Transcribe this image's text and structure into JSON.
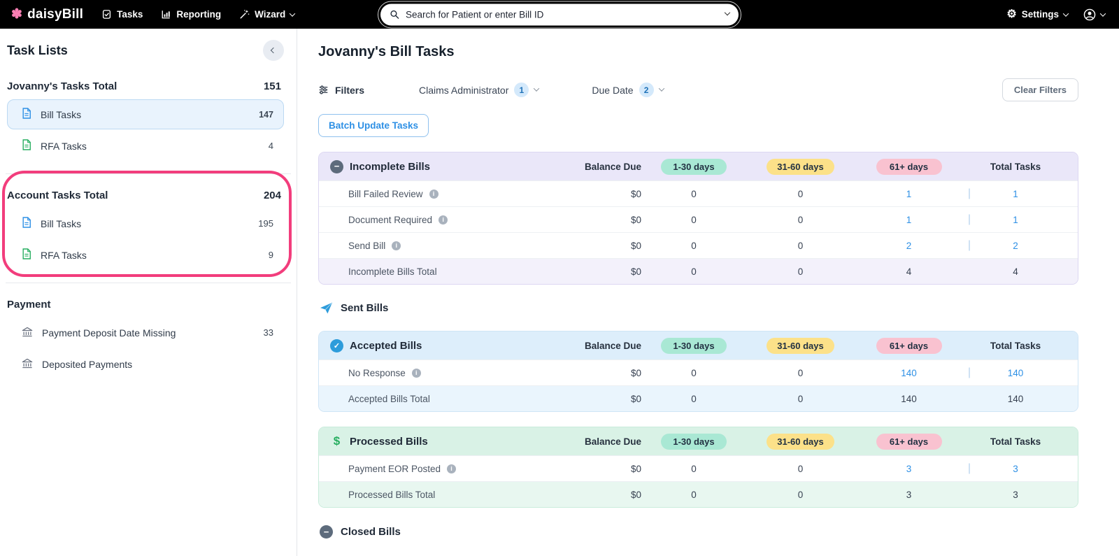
{
  "navbar": {
    "brand": "daisyBill",
    "tasks_label": "Tasks",
    "reporting_label": "Reporting",
    "wizard_label": "Wizard",
    "search_placeholder": "Search for Patient or enter Bill ID",
    "settings_label": "Settings"
  },
  "sidebar": {
    "title": "Task Lists",
    "sections": [
      {
        "heading": "Jovanny's Tasks Total",
        "count": "151",
        "items": [
          {
            "label": "Bill Tasks",
            "count": "147"
          },
          {
            "label": "RFA Tasks",
            "count": "4"
          }
        ]
      },
      {
        "heading": "Account Tasks Total",
        "count": "204",
        "items": [
          {
            "label": "Bill Tasks",
            "count": "195"
          },
          {
            "label": "RFA Tasks",
            "count": "9"
          }
        ]
      },
      {
        "heading": "Payment",
        "count": "",
        "items": [
          {
            "label": "Payment Deposit Date Missing",
            "count": "33"
          },
          {
            "label": "Deposited Payments",
            "count": ""
          }
        ]
      }
    ]
  },
  "main": {
    "title": "Jovanny's Bill Tasks",
    "filters_label": "Filters",
    "claims_admin_label": "Claims Administrator",
    "claims_admin_badge": "1",
    "due_date_label": "Due Date",
    "due_date_badge": "2",
    "clear_filters_label": "Clear Filters",
    "batch_update_label": "Batch Update Tasks",
    "sent_bills_label": "Sent Bills",
    "closed_bills_label": "Closed Bills",
    "columns": {
      "balance": "Balance Due",
      "d1": "1-30 days",
      "d2": "31-60 days",
      "d3": "61+ days",
      "total": "Total Tasks"
    },
    "tables": [
      {
        "title": "Incomplete Bills",
        "rows": [
          {
            "label": "Bill Failed Review",
            "balance": "$0",
            "d1": "0",
            "d2": "0",
            "d3": "1",
            "total": "1"
          },
          {
            "label": "Document Required",
            "balance": "$0",
            "d1": "0",
            "d2": "0",
            "d3": "1",
            "total": "1"
          },
          {
            "label": "Send Bill",
            "balance": "$0",
            "d1": "0",
            "d2": "0",
            "d3": "2",
            "total": "2"
          }
        ],
        "total_row": {
          "label": "Incomplete Bills Total",
          "balance": "$0",
          "d1": "0",
          "d2": "0",
          "d3": "4",
          "total": "4"
        }
      },
      {
        "title": "Accepted Bills",
        "rows": [
          {
            "label": "No Response",
            "balance": "$0",
            "d1": "0",
            "d2": "0",
            "d3": "140",
            "total": "140"
          }
        ],
        "total_row": {
          "label": "Accepted Bills Total",
          "balance": "$0",
          "d1": "0",
          "d2": "0",
          "d3": "140",
          "total": "140"
        }
      },
      {
        "title": "Processed Bills",
        "rows": [
          {
            "label": "Payment EOR Posted",
            "balance": "$0",
            "d1": "0",
            "d2": "0",
            "d3": "3",
            "total": "3"
          }
        ],
        "total_row": {
          "label": "Processed Bills Total",
          "balance": "$0",
          "d1": "0",
          "d2": "0",
          "d3": "3",
          "total": "3"
        }
      }
    ]
  },
  "colors": {
    "accent_blue": "#2e90e5",
    "pill_teal": "#a9e8d4",
    "pill_yellow": "#fce189",
    "pill_pink": "#f9c2d0",
    "header_purple": "#eae7f9",
    "header_blue": "#ddeefb",
    "header_green": "#d9f2e6",
    "annotation_pink": "#f23d7c"
  }
}
